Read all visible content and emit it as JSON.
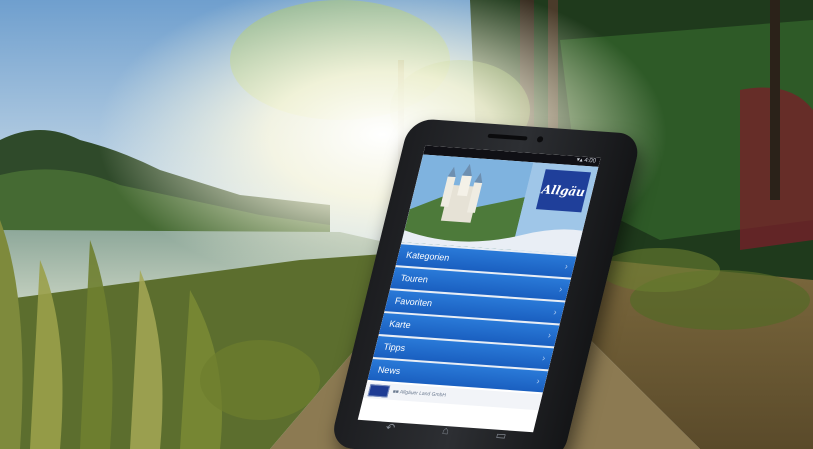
{
  "scene": {
    "accent_bar_color": "#7ec242"
  },
  "phone": {
    "status": "▾▴ 4:00",
    "logo_text": "Allgäu",
    "menu_items": [
      {
        "label": "Kategorien"
      },
      {
        "label": "Touren"
      },
      {
        "label": "Favoriten"
      },
      {
        "label": "Karte"
      },
      {
        "label": "Tipps"
      },
      {
        "label": "News"
      }
    ],
    "footer_text": "■■ Allgäuer Land GmbH",
    "nav_icons": [
      "back-icon",
      "home-icon",
      "recent-apps-icon"
    ]
  }
}
